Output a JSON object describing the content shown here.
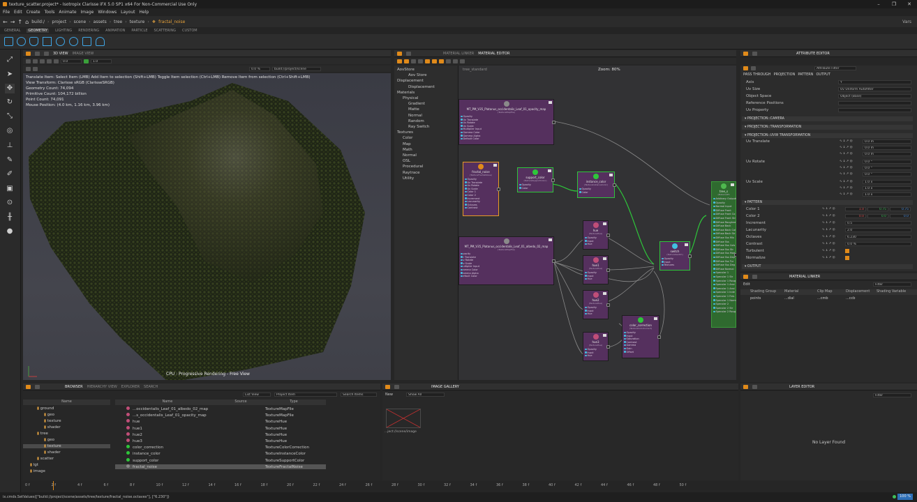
{
  "window": {
    "title": "texture_scatter.project* - Isotropix Clarisse iFX 5.0 SP1 x64   For Non-Commercial Use Only",
    "min": "–",
    "max": "❐",
    "close": "✕"
  },
  "menu": [
    "File",
    "Edit",
    "Create",
    "Tools",
    "Animate",
    "Image",
    "Windows",
    "Layout",
    "Help"
  ],
  "path": {
    "crumbs": [
      "build:/",
      "project",
      "scene",
      "assets",
      "tree",
      "texture"
    ],
    "current": "fractal_noise",
    "right": "Vars"
  },
  "shelf": {
    "tabs": [
      "GENERAL",
      "GEOMETRY",
      "LIGHTING",
      "RENDERING",
      "ANIMATION",
      "PARTICLE",
      "SCATTERING",
      "CUSTOM"
    ],
    "active": "GEOMETRY"
  },
  "viewport": {
    "tabs": [
      "3D VIEW",
      "IMAGE VIEW"
    ],
    "fields": [
      "0.0",
      "1.0",
      "0.0 %"
    ],
    "infopath": "build://project/scene",
    "lines": [
      "Translate Item: Select Item (LMB)   Add Item to selection (Shift+LMB)   Toggle Item selection (Ctrl+LMB)   Remove Item from selection (Ctrl+Shift+LMB)",
      "View Transform: Clarisse sRGB (ClarisseSRGB)",
      "Geometry Count: 74,094",
      "Primitive Count: 104,172 billion",
      "Point Count: 74,091",
      "Mouse Position: (4.0 km, 1.16 km, 3.96 km)"
    ],
    "render_label": "CPU : Progressive Rendering - Free View"
  },
  "nodeeditor": {
    "tabs": [
      "MATERIAL LINKER",
      "MATERIAL EDITOR"
    ],
    "context": "tree_standard",
    "zoom": "Zoom: 80%",
    "tree": [
      {
        "t": "AovStore",
        "d": 0
      },
      {
        "t": "Aov Store",
        "d": 2
      },
      {
        "t": "Displacement",
        "d": 0
      },
      {
        "t": "Displacement",
        "d": 2
      },
      {
        "t": "Materials",
        "d": 0
      },
      {
        "t": "Physical",
        "d": 1
      },
      {
        "t": "Gradient",
        "d": 2
      },
      {
        "t": "Matte",
        "d": 2
      },
      {
        "t": "Normal",
        "d": 2
      },
      {
        "t": "Random",
        "d": 2
      },
      {
        "t": "Ray Switch",
        "d": 2
      },
      {
        "t": "Textures",
        "d": 0
      },
      {
        "t": "Color",
        "d": 1
      },
      {
        "t": "Map",
        "d": 1
      },
      {
        "t": "Math",
        "d": 1
      },
      {
        "t": "Normal",
        "d": 1
      },
      {
        "t": "OSL",
        "d": 1
      },
      {
        "t": "Procedural",
        "d": 1
      },
      {
        "t": "Raytrace",
        "d": 1
      },
      {
        "t": "Utility",
        "d": 1
      }
    ],
    "nodes": {
      "opacity_map": {
        "title": "MT_PM_V35_Platanus_occidentalis_Leaf_01_opacity_map",
        "sub": "(TextureMapFile)",
        "pins": [
          "Opacity",
          "Uv Translate",
          "Uv Rotate",
          "Uv Scale",
          "Multiplier Input",
          "Gamma Color",
          "Gamma Alpha",
          "Default Color"
        ]
      },
      "fractal_noise": {
        "title": "fractal_noise",
        "sub": "(TextureFractalNoise)",
        "pins": [
          "Opacity",
          "Uv Translate",
          "Uv Rotate",
          "Uv Scale",
          "Color 1",
          "Color 2",
          "Increment",
          "Lacunarity",
          "Octaves",
          "Contrast"
        ]
      },
      "support_color": {
        "title": "support_color",
        "sub": "(TextureSupportColor)",
        "pins": [
          "Opacity",
          "Color"
        ]
      },
      "instance_color": {
        "title": "instance_color",
        "sub": "(TextureInstanceColor)",
        "pins": [
          "Opacity",
          "Color"
        ]
      },
      "albedo_map": {
        "title": "MT_PM_V35_Platanus_occidentalis_Leaf_01_albedo_02_map",
        "sub": "(TextureMapFile)",
        "pins": [
          "pacity",
          "r Translate",
          "v Rotate",
          "v Scale",
          "ultiplier Input",
          "amma Color",
          "amma Alpha",
          "efault Color"
        ]
      },
      "hue": {
        "title": "hue",
        "sub": "(TextureHue)",
        "pins": [
          "Opacity",
          "Input",
          "Hue"
        ]
      },
      "hue1": {
        "title": "hue1",
        "sub": "(TextureHue)",
        "pins": [
          "Opacity",
          "Input",
          "Hue"
        ]
      },
      "hue2": {
        "title": "hue2",
        "sub": "(TextureHue)",
        "pins": [
          "Opacity",
          "Input",
          "Hue"
        ]
      },
      "hue3": {
        "title": "hue3",
        "sub": "(TextureHue)",
        "pins": [
          "Opacity",
          "Input",
          "Hue"
        ]
      },
      "switch": {
        "title": "switch",
        "sub": "(TextureSwitch)",
        "pins": [
          "Opacity",
          "Input",
          "Textures"
        ]
      },
      "color_correction": {
        "title": "color_correction",
        "sub": "(TextureColorCorrect)",
        "pins": [
          "Opacity",
          "Input",
          "Saturation",
          "Contrast",
          "Gamma",
          "Gain",
          "Offset"
        ]
      },
      "tree_standard": {
        "title": "tree_s",
        "sub": "(MaterialPh",
        "pins": [
          "Arbitrary Outputs",
          "Opacity",
          "Normal Input",
          "Diffuse Front",
          "Diffuse Front Co",
          "Diffuse Front Str",
          "Diffuse Roughne",
          "Diffuse Back",
          "Diffuse Back Col",
          "Diffuse Back Str",
          "Diffuse Sss Mix",
          "Diffuse Sss",
          "Diffuse Sss Cols",
          "Diffuse Sss Str",
          "Diffuse Sss Mod",
          "Diffuse Sss Dep",
          "Diffuse Sss Tur",
          "Diffuse Sss Deg",
          "Diffuse Normal",
          "Specular 1",
          "Specular 1 Str",
          "Specular 1 Roug",
          "Specular 1 Ansi",
          "Specular 1 Ansi",
          "Specular 1 Inde",
          "Specular 1 Fres",
          "Specular 1 Norm",
          "Specular 2",
          "Specular 2 Str",
          "Specular 2 Roug"
        ]
      }
    }
  },
  "attributes": {
    "tabs": [
      "PASS THROUGH",
      "PROJECTION",
      "PATTERN",
      "OUTPUT"
    ],
    "header": "ATTRIBUTE EDITOR",
    "filter": "Attribute Filter",
    "rows": [
      {
        "label": "Axis",
        "value": "Y"
      },
      {
        "label": "Uv Size",
        "value": "Uv Uniform Autofilter"
      },
      {
        "label": "Object Space",
        "value": "Object (Base)"
      },
      {
        "label": "Reference Positions",
        "value": ""
      },
      {
        "label": "Uv Property",
        "value": ""
      }
    ],
    "sections": [
      "PROJECTION::CAMERA",
      "PROJECTION::TRANSFORMATION",
      "PROJECTION::UVW TRANSFORMATION",
      "PATTERN",
      "OUTPUT"
    ],
    "uvw": [
      {
        "label": "Uv Translate",
        "vals": [
          "0.0 m",
          "0.0 m",
          "0.0 m"
        ]
      },
      {
        "label": "Uv Rotate",
        "vals": [
          "0.0 °",
          "0.0 °",
          "0.0 °"
        ]
      },
      {
        "label": "Uv Scale",
        "vals": [
          "1.0 x",
          "1.0 x",
          "1.0 x"
        ]
      }
    ],
    "pattern": [
      {
        "label": "Color 1",
        "vals": [
          "1.0",
          "0.75",
          "0.75"
        ]
      },
      {
        "label": "Color 2",
        "vals": [
          "0.0",
          "0.0",
          "0.0"
        ]
      },
      {
        "label": "Increment",
        "vals": [
          "0.5"
        ]
      },
      {
        "label": "Lacunarity",
        "vals": [
          "2.0"
        ]
      },
      {
        "label": "Octaves",
        "vals": [
          "6.230"
        ]
      },
      {
        "label": "Contrast",
        "vals": [
          "0.0 %"
        ]
      },
      {
        "label": "Turbulent",
        "vals": [
          ""
        ]
      },
      {
        "label": "Normalize",
        "vals": [
          ""
        ]
      }
    ],
    "colors": {
      "red": "#e05353",
      "green": "#3fbf5a",
      "blue": "#4a8fe0",
      "accent": "#e08a1a"
    }
  },
  "matlinker": {
    "header": "MATERIAL LINKER",
    "filter": "Filter",
    "cols": [
      "Shading Group",
      "Material",
      "Clip Map",
      "Displacement",
      "Shading Variable"
    ],
    "row": {
      "name": "points",
      "mat": "...dial",
      "clip": "...cmb",
      "disp": "...ccb"
    },
    "edit": "Edit"
  },
  "browser": {
    "tabs": [
      "BROWSER",
      "HIERARCHY VIEW",
      "EXPLORER",
      "SEARCH"
    ],
    "viewmode": "List View",
    "filter": "Project Item",
    "search": "Search Items",
    "tree_header": "Name",
    "tree": [
      {
        "t": "ground",
        "d": 1
      },
      {
        "t": "geo",
        "d": 2
      },
      {
        "t": "texture",
        "d": 2
      },
      {
        "t": "shader",
        "d": 2
      },
      {
        "t": "tree",
        "d": 1
      },
      {
        "t": "geo",
        "d": 2
      },
      {
        "t": "texture",
        "d": 2,
        "sel": true
      },
      {
        "t": "shader",
        "d": 2
      },
      {
        "t": "scatter",
        "d": 1
      },
      {
        "t": "lgt",
        "d": 0
      },
      {
        "t": "image",
        "d": 0
      }
    ],
    "cols": [
      "Name",
      "Source",
      "Type"
    ],
    "items": [
      {
        "name": "...occidentalis_Leaf_01_albedo_02_map",
        "type": "TextureMapFile",
        "c": "#c04e78"
      },
      {
        "name": "...s_occidentalis_Leaf_01_opacity_map",
        "type": "TextureMapFile",
        "c": "#c04e78"
      },
      {
        "name": "hue",
        "type": "TextureHue",
        "c": "#c04e78"
      },
      {
        "name": "hue1",
        "type": "TextureHue",
        "c": "#c04e78"
      },
      {
        "name": "hue2",
        "type": "TextureHue",
        "c": "#c04e78"
      },
      {
        "name": "hue3",
        "type": "TextureHue",
        "c": "#c04e78"
      },
      {
        "name": "color_correction",
        "type": "TextureColorCorrection",
        "c": "#2ec63a"
      },
      {
        "name": "instance_color",
        "type": "TextureInstanceColor",
        "c": "#2ec63a"
      },
      {
        "name": "support_color",
        "type": "TextureSupportColor",
        "c": "#2ec63a"
      },
      {
        "name": "fractal_noise",
        "type": "TextureFractalNoise",
        "c": "#888888",
        "sel": true
      }
    ]
  },
  "gallery": {
    "header": "IMAGE GALLERY",
    "new": "New",
    "show": "Show All",
    "thumb": "...ject://scene/image"
  },
  "layer": {
    "header": "LAYER EDITOR",
    "empty": "No Layer Found",
    "filter": "Filter"
  },
  "timeline": {
    "ticks": [
      "0 f",
      "2 f",
      "4 f",
      "6 f",
      "8 f",
      "10 f",
      "12 f",
      "14 f",
      "16 f",
      "18 f",
      "20 f",
      "22 f",
      "24 f",
      "26 f",
      "28 f",
      "30 f",
      "32 f",
      "34 f",
      "36 f",
      "38 f",
      "40 f",
      "42 f",
      "44 f",
      "46 f",
      "48 f",
      "50 f"
    ],
    "range": [
      "0.0 f",
      "50.0 f"
    ]
  },
  "status": {
    "cmd": "ix.cmds.SetValues([\"build://project/scene/assets/tree/texture/fractal_noise.octaves\"], [\"6.230\"])",
    "zoom": "100 %"
  }
}
